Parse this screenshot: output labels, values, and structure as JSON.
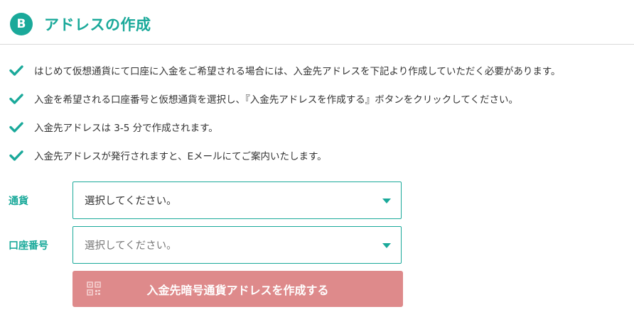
{
  "header": {
    "badge_symbol": "B",
    "title": "アドレスの作成"
  },
  "notes": [
    "はじめて仮想通貨にて口座に入金をご希望される場合には、入金先アドレスを下記より作成していただく必要があります。",
    "入金を希望される口座番号と仮想通貨を選択し、『入金先アドレスを作成する』ボタンをクリックしてください。",
    "入金先アドレスは 3-5 分で作成されます。",
    "入金先アドレスが発行されますと、Eメールにてご案内いたします。"
  ],
  "form": {
    "currency": {
      "label": "通貨",
      "value": "選択してください。"
    },
    "account": {
      "label": "口座番号",
      "value": "選択してください。"
    },
    "submit_label": "入金先暗号通貨アドレスを作成する"
  },
  "colors": {
    "accent": "#1aa99a",
    "button_disabled": "#de8a8b"
  },
  "icons": {
    "badge": "bitcoin-icon",
    "bullet": "check-icon",
    "select": "chevron-down-icon",
    "button": "qr-code-icon"
  }
}
